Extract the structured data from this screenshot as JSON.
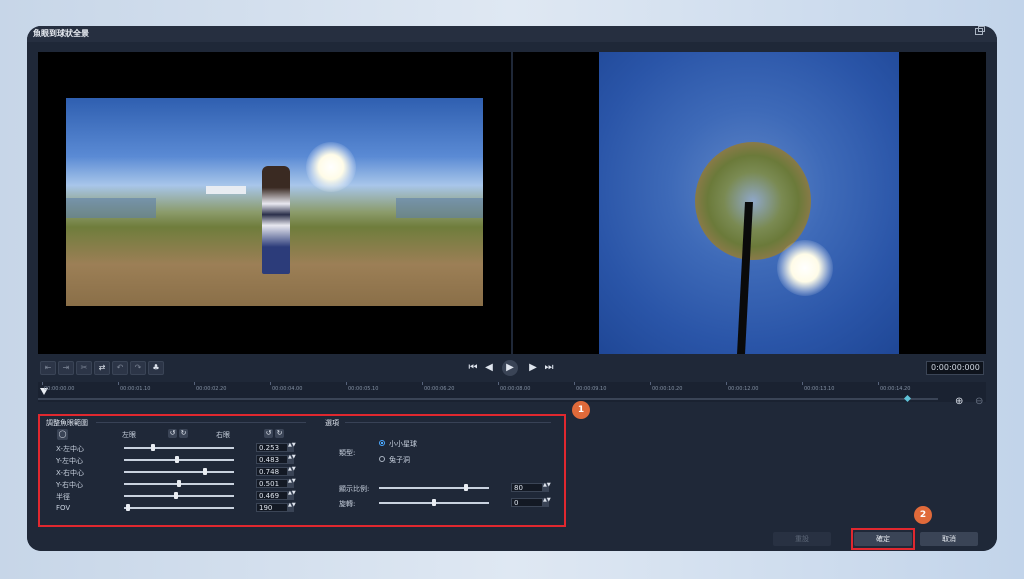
{
  "window": {
    "title": "魚眼到球狀全景"
  },
  "timecode": "0:00:00:000",
  "timeline": {
    "ticks": [
      "00:00:00.00",
      "00:00:01.10",
      "00:00:02.20",
      "00:00:04.00",
      "00:00:05.10",
      "00:00:06.20",
      "00:00:08.00",
      "00:00:09.10",
      "00:00:10.20",
      "00:00:12.00",
      "00:00:13.10",
      "00:00:14.20"
    ]
  },
  "fisheye": {
    "title": "調整魚眼範圍",
    "left_label": "左眼",
    "right_label": "右眼",
    "rows": [
      {
        "label": "X-左中心",
        "value": "0.253",
        "level": 0.253
      },
      {
        "label": "Y-左中心",
        "value": "0.483",
        "level": 0.483
      },
      {
        "label": "X-右中心",
        "value": "0.748",
        "level": 0.748
      },
      {
        "label": "Y-右中心",
        "value": "0.501",
        "level": 0.501
      },
      {
        "label": "半徑",
        "value": "0.469",
        "level": 0.469
      },
      {
        "label": "FOV",
        "value": "190",
        "level": 0.02
      }
    ]
  },
  "options": {
    "title": "選項",
    "type_label": "類型:",
    "type_options": [
      "小小星球",
      "兔子洞"
    ],
    "selected_type": 0,
    "ratio_label": "顯示比例:",
    "ratio_value": "80",
    "ratio_level": 0.8,
    "rotate_label": "旋轉:",
    "rotate_value": "0",
    "rotate_level": 0.5
  },
  "badges": [
    "1",
    "2"
  ],
  "footer": {
    "reset": "重設",
    "ok": "確定",
    "cancel": "取消"
  }
}
